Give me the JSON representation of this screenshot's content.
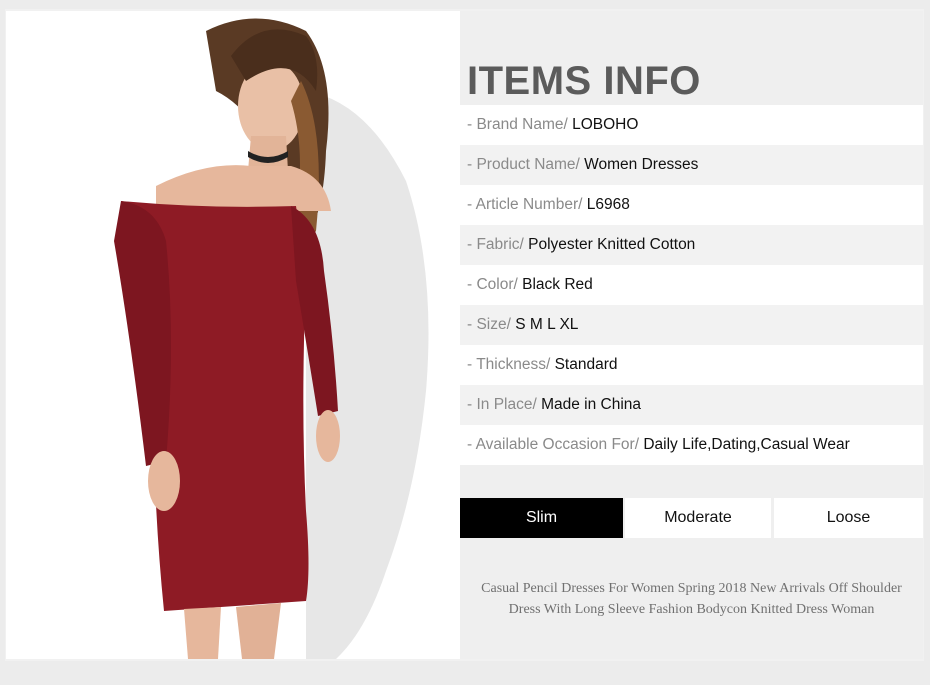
{
  "items_info": {
    "title": "ITEMS INFO",
    "rows": [
      {
        "label": "- Brand Name/ ",
        "value": "LOBOHO"
      },
      {
        "label": "- Product Name/ ",
        "value": "Women Dresses"
      },
      {
        "label": "- Article Number/ ",
        "value": "L6968"
      },
      {
        "label": "- Fabric/ ",
        "value": "Polyester Knitted Cotton"
      },
      {
        "label": "- Color/ ",
        "value": "Black Red"
      },
      {
        "label": "- Size/ ",
        "value": "S M L XL"
      },
      {
        "label": "- Thickness/ ",
        "value": "Standard"
      },
      {
        "label": "- In Place/ ",
        "value": "Made in China"
      },
      {
        "label": "- Available Occasion For/ ",
        "value": "Daily Life,Dating,Casual Wear"
      }
    ]
  },
  "fit": {
    "options": [
      "Slim",
      "Moderate",
      "Loose"
    ],
    "selected": "Slim"
  },
  "description": {
    "line1": "Casual Pencil Dresses For Women Spring 2018 New Arrivals Off Shoulder",
    "line2": "Dress With Long Sleeve Fashion Bodycon Knitted Dress Woman"
  },
  "colors": {
    "dress": "#8e1b25",
    "title": "#5b5b5b",
    "label": "#8a8a8a",
    "value": "#111111",
    "active_bg": "#000000"
  },
  "photo": {
    "icon": "model-photo"
  }
}
